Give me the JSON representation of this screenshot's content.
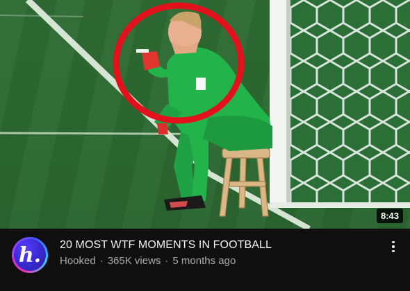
{
  "video": {
    "title": "20 MOST WTF MOMENTS IN FOOTBALL",
    "duration": "8:43",
    "channel": "Hooked",
    "views": "365K views",
    "published": "5 months ago",
    "thumbnail_description": "goalkeeper sitting on a wooden stool by the goal post, red circle highlight",
    "avatar_letter": "h."
  },
  "icons": {
    "more": "more-vert-icon"
  },
  "colors": {
    "background": "#0f0f0f",
    "title_text": "#f1f1f1",
    "meta_text": "#aaaaaa",
    "highlight_circle": "#e3111b",
    "jersey": "#22b34a"
  }
}
